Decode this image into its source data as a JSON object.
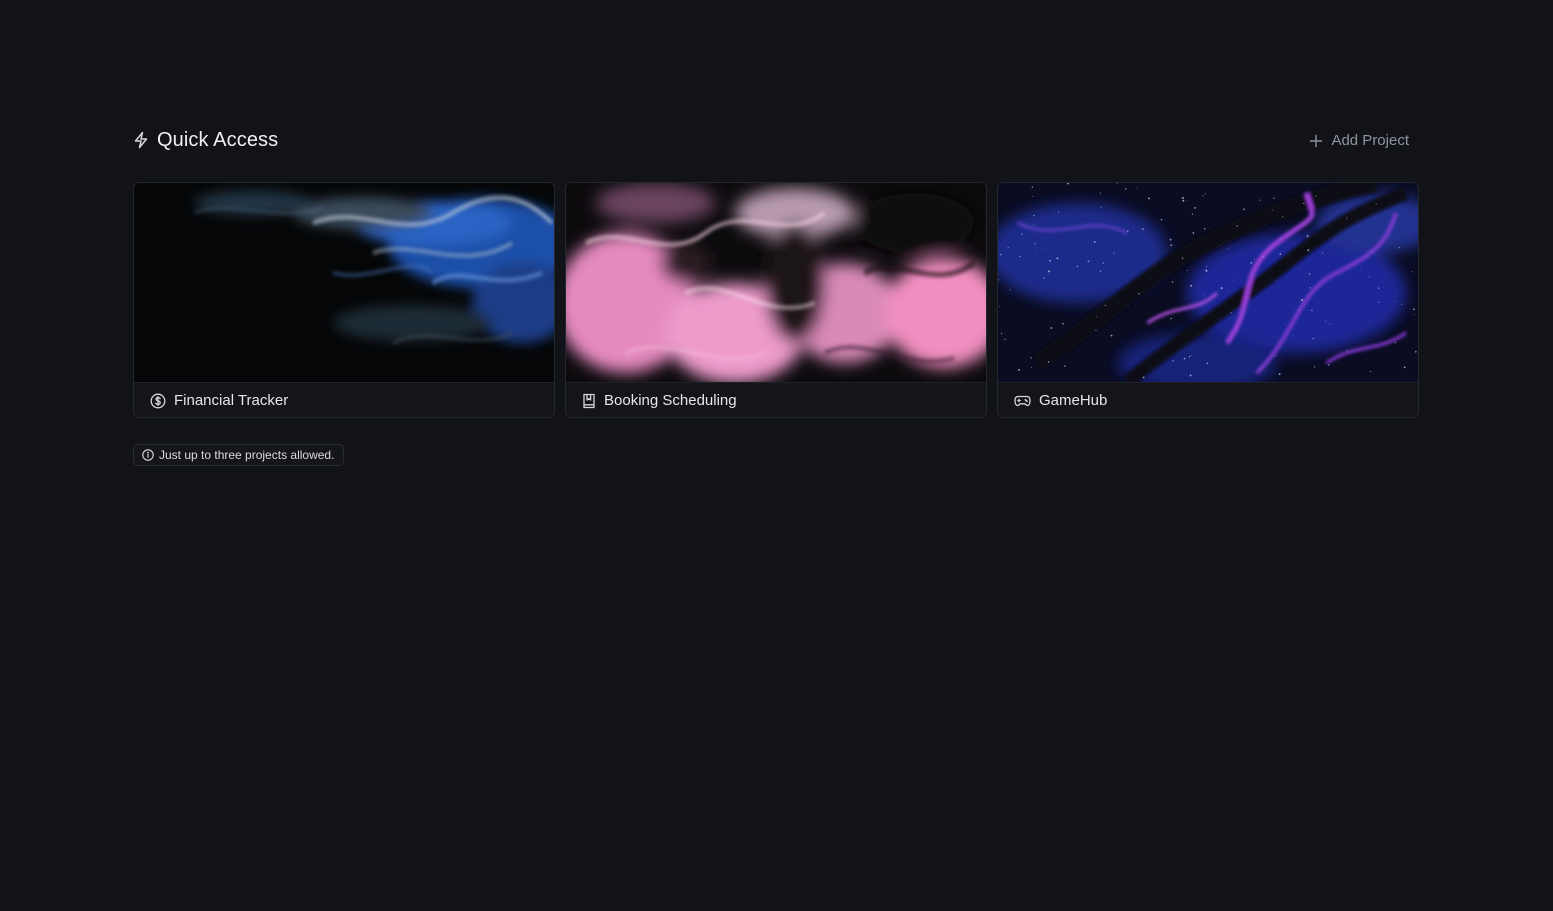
{
  "section": {
    "title": "Quick Access",
    "icon": "lightning-icon",
    "add_button_label": "Add Project",
    "add_button_icon": "plus-icon"
  },
  "projects": [
    {
      "label": "Financial Tracker",
      "icon": "dollar-circle-icon",
      "theme": "blue-marble"
    },
    {
      "label": "Booking Scheduling",
      "icon": "bookmark-book-icon",
      "theme": "pink-marble"
    },
    {
      "label": "GameHub",
      "icon": "gamepad-icon",
      "theme": "purple-galaxy"
    }
  ],
  "notice": {
    "text": "Just up to three projects allowed.",
    "icon": "info-icon"
  },
  "colors": {
    "background": "#121318",
    "card_border": "#25272e",
    "muted_text": "#8f939c"
  }
}
